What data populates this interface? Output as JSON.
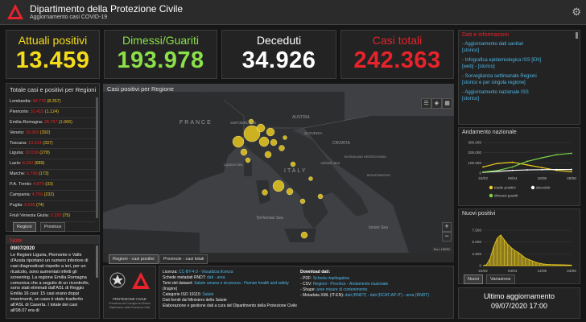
{
  "header": {
    "title": "Dipartimento della Protezione Civile",
    "subtitle": "Aggiornamento casi COVID-19"
  },
  "kpis": {
    "attuali": {
      "label": "Attuali positivi",
      "value": "13.459",
      "color": "#f5dc1b"
    },
    "dimessi": {
      "label": "Dimessi/Guariti",
      "value": "193.978",
      "color": "#8be04a"
    },
    "deceduti": {
      "label": "Deceduti",
      "value": "34.926",
      "color": "#ffffff"
    },
    "totali": {
      "label": "Casi totali",
      "value": "242.363",
      "color": "#e8232b"
    }
  },
  "regions": {
    "title": "Totale casi e positivi per Regioni",
    "rows": [
      {
        "name": "Lombardia:",
        "total": "94.778",
        "pos": "(8.357)"
      },
      {
        "name": "Piemonte:",
        "total": "31.415",
        "pos": "(1.124)"
      },
      {
        "name": "Emilia-Romagna:",
        "total": "28.767",
        "pos": "(1.066)"
      },
      {
        "name": "Veneto:",
        "total": "19.309",
        "pos": "(392)"
      },
      {
        "name": "Toscana:",
        "total": "10.314",
        "pos": "(337)"
      },
      {
        "name": "Liguria:",
        "total": "10.016",
        "pos": "(278)"
      },
      {
        "name": "Lazio:",
        "total": "8.262",
        "pos": "(689)"
      },
      {
        "name": "Marche:",
        "total": "6.796",
        "pos": "(173)"
      },
      {
        "name": "P.A. Trento:",
        "total": "4.870",
        "pos": "(33)"
      },
      {
        "name": "Campania:",
        "total": "4.759",
        "pos": "(232)"
      },
      {
        "name": "Puglia:",
        "total": "4.536",
        "pos": "(74)"
      },
      {
        "name": "Friuli Venezia Giulia:",
        "total": "3.333",
        "pos": "(75)"
      }
    ],
    "tabs": [
      "Regioni",
      "Province"
    ]
  },
  "note": {
    "title": "Note",
    "date": "09/07/2020",
    "text": "Le Regioni Liguria, Piemonte e Valle d'Aosta riportano un numero inferiore di casi diagnosticati rispetto a ieri, per un ricalcolo, sono aumentati infetti gli screening. La regione Emilia Romagna comunica che a seguito di un ricontrollo, sono stati eliminati dall'ASL di Reggio Emilia 16 casi: 15 casi erano doppi inserimenti, un caso è stato trasferito all'ASL di Caserta. I totale dei casi all'08.07 era di"
  },
  "logos": {
    "line1": "PROTEZIONE CIVILE",
    "line2": "Presidenza del Consiglio dei Ministri",
    "line3": "Dipartimento della Protezione Civile"
  },
  "map": {
    "title": "Casi positivi per Regione",
    "labels": [
      "FRANCE",
      "SWITZERLAND",
      "AUSTRIA",
      "SLOVENIA",
      "CROATIA",
      "BOSNIA AND HERZEGOVINA",
      "MONTENEGRO",
      "ITALY",
      "Tyrrhenian Sea",
      "Ionian Sea",
      "Ligurian Sea",
      "Adriatic Sea"
    ],
    "attribution": "Esri, HERE",
    "tabs": [
      "Regioni - casi positivi",
      "Provincie - casi totali"
    ]
  },
  "license": {
    "left": [
      {
        "k": "Licenza:",
        "v": "CC-BY-4.0 - Visualizza licenza"
      },
      {
        "k": "Schede metadati RNDT:",
        "v": "dati - area"
      },
      {
        "k": "Temi del dataset:",
        "v": "Salute umana e sicurezza - Human health and safety"
      },
      {
        "k": "(Inspire)",
        "v": ""
      },
      {
        "k": "Categorie ISO 19115:",
        "v": "Salute"
      },
      {
        "k": "Dati forniti dal Ministero della Salute",
        "v": ""
      },
      {
        "k": "Elaborazione e gestione dati a cura del Dipartimento della Protezione Civile",
        "v": ""
      }
    ],
    "right_title": "Download dati:",
    "right": [
      {
        "k": "- PDF:",
        "v": "Scheda riepilogativa"
      },
      {
        "k": "- CSV:",
        "v": "Regioni - Province - Andamento nazionale"
      },
      {
        "k": "- Shape:",
        "v": "aree misure di contenimento"
      },
      {
        "k": "- Metadata XML (IT-EN):",
        "v": "dati (RNDT) - dati (DCAT-AP-IT) - area (RNDT)"
      }
    ]
  },
  "info": {
    "title": "Dati e informazioni",
    "items": [
      {
        "text": "Aggiornamento dati sanitari",
        "sub": "[storico]"
      },
      {
        "text": "Infografica epidemiologica ISS [EN]",
        "sub": "[web] - [storico]"
      },
      {
        "text": "Sorveglianza settimanale Regioni",
        "sub": "[storico e per singola regione]"
      },
      {
        "text": "Aggiornamento nazionale ISS",
        "sub": "[storico]"
      }
    ]
  },
  "andamento": {
    "title": "Andamento nazionale",
    "legend": [
      "totale positivi",
      "deceduti",
      "dimessi guariti"
    ],
    "colors": [
      "#f0d020",
      "#ffffff",
      "#7bd84a"
    ]
  },
  "nuovi": {
    "title": "Nuovi positivi",
    "tabs": [
      "Nuovi",
      "Variazione"
    ]
  },
  "update": {
    "label": "Ultimo aggiornamento",
    "value": "09/07/2020 17:00"
  },
  "chart_data": [
    {
      "type": "line",
      "title": "Andamento nazionale",
      "x": [
        "24/03",
        "06/04",
        "18/05",
        "29/06"
      ],
      "yticks": [
        "300.000",
        "200.000",
        "100.000",
        "0"
      ],
      "ylim": [
        0,
        300000
      ],
      "series": [
        {
          "name": "totale positivi",
          "color": "#f0d020",
          "values": [
            60000,
            95000,
            106000,
            80000,
            54000,
            26000,
            14000
          ]
        },
        {
          "name": "deceduti",
          "color": "#ffffff",
          "values": [
            8000,
            17000,
            26000,
            31000,
            33000,
            34500,
            34900
          ]
        },
        {
          "name": "dimessi guariti",
          "color": "#7bd84a",
          "values": [
            10000,
            25000,
            60000,
            115000,
            150000,
            180000,
            194000
          ]
        }
      ]
    },
    {
      "type": "area",
      "title": "Nuovi positivi",
      "x": [
        "24/02",
        "04/04",
        "14/05",
        "23/06"
      ],
      "yticks": [
        "7.500",
        "5.000",
        "2.500",
        "0"
      ],
      "ylim": [
        0,
        7500
      ],
      "values": [
        0,
        200,
        1500,
        4000,
        5800,
        6500,
        5500,
        4500,
        3800,
        3200,
        2800,
        2200,
        1600,
        1300,
        1000,
        700,
        500,
        350,
        280,
        230,
        200,
        180,
        190,
        160,
        140,
        130
      ]
    }
  ]
}
